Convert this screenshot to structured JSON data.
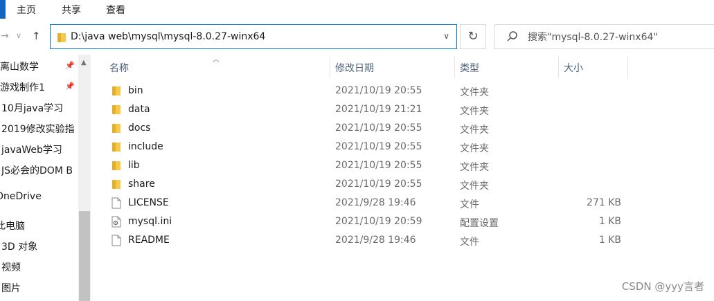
{
  "ribbon": {
    "tabs": [
      "主页",
      "共享",
      "查看"
    ]
  },
  "address": {
    "path": "D:\\java web\\mysql\\mysql-8.0.27-winx64"
  },
  "search": {
    "placeholder": "搜索\"mysql-8.0.27-winx64\""
  },
  "sidebar": {
    "items": [
      {
        "label": "离山数学",
        "pinned": true
      },
      {
        "label": "游戏制作1",
        "pinned": true
      },
      {
        "label": "10月java学习",
        "pinned": false
      },
      {
        "label": "2019修改实验指",
        "pinned": false
      },
      {
        "label": "javaWeb学习",
        "pinned": false
      },
      {
        "label": "JS必会的DOM B",
        "pinned": false
      },
      {
        "label": "OneDrive",
        "pinned": false
      },
      {
        "label": "此电脑",
        "pinned": false
      },
      {
        "label": "3D 对象",
        "pinned": false
      },
      {
        "label": "视频",
        "pinned": false
      },
      {
        "label": "图片",
        "pinned": false
      }
    ]
  },
  "columns": {
    "name": "名称",
    "modified": "修改日期",
    "type": "类型",
    "size": "大小"
  },
  "files": [
    {
      "name": "bin",
      "modified": "2021/10/19 20:55",
      "type": "文件夹",
      "size": "",
      "icon": "folder-icon"
    },
    {
      "name": "data",
      "modified": "2021/10/19 21:21",
      "type": "文件夹",
      "size": "",
      "icon": "folder-icon"
    },
    {
      "name": "docs",
      "modified": "2021/10/19 20:55",
      "type": "文件夹",
      "size": "",
      "icon": "folder-icon"
    },
    {
      "name": "include",
      "modified": "2021/10/19 20:55",
      "type": "文件夹",
      "size": "",
      "icon": "folder-icon"
    },
    {
      "name": "lib",
      "modified": "2021/10/19 20:55",
      "type": "文件夹",
      "size": "",
      "icon": "folder-icon"
    },
    {
      "name": "share",
      "modified": "2021/10/19 20:55",
      "type": "文件夹",
      "size": "",
      "icon": "folder-icon"
    },
    {
      "name": "LICENSE",
      "modified": "2021/9/28 19:46",
      "type": "文件",
      "size": "271 KB",
      "icon": "file-icon"
    },
    {
      "name": "mysql.ini",
      "modified": "2021/10/19 20:59",
      "type": "配置设置",
      "size": "1 KB",
      "icon": "settings-file-icon"
    },
    {
      "name": "README",
      "modified": "2021/9/28 19:46",
      "type": "文件",
      "size": "1 KB",
      "icon": "file-icon"
    }
  ],
  "watermark": "CSDN @yyy言者",
  "colors": {
    "accent": "#0078d7",
    "folder": "#f6c94b",
    "header_text": "#4c607a"
  }
}
